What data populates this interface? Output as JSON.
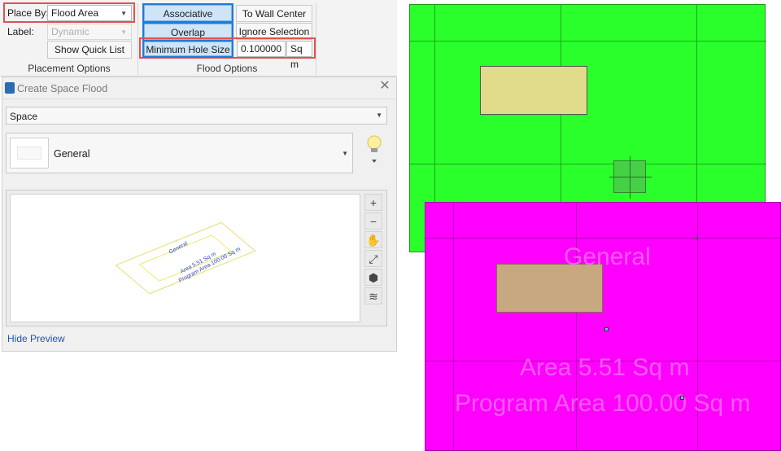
{
  "ribbon": {
    "place_by_label": "Place By:",
    "place_by_value": "Flood Area",
    "label_label": "Label:",
    "label_value": "Dynamic",
    "show_quick_list": "Show Quick List",
    "placement_options_title": "Placement Options",
    "associative": "Associative",
    "to_wall_center": "To Wall Center",
    "overlap": "Overlap",
    "ignore_selection": "Ignore Selection",
    "min_hole_size": "Minimum Hole Size",
    "min_hole_value": "0.100000",
    "min_hole_unit": "Sq m",
    "flood_options_title": "Flood Options"
  },
  "dialog": {
    "title": "Create Space Flood",
    "type_value": "Space",
    "template_name": "General",
    "hide_preview": "Hide Preview",
    "preview_labels": [
      "General",
      "Area 5.51 Sq m",
      "Program Area 100.00 Sq m"
    ]
  },
  "canvas": {
    "space_label": "General",
    "area_label": "Area 5.51 Sq m",
    "program_area_label": "Program Area 100.00 Sq m",
    "colors": {
      "green_space": "#2bff2b",
      "magenta_space": "#ff00ff",
      "column_yellow": "#e0dc8c",
      "column_tan": "#c8a880",
      "magenta_text": "#f45cf4"
    }
  }
}
